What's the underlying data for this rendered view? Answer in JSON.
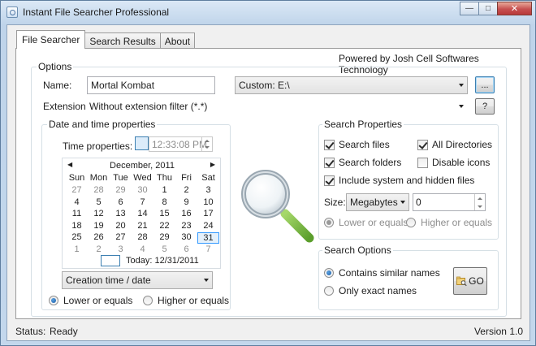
{
  "window": {
    "title": "Instant File Searcher Professional",
    "controls": [
      "minimize-icon",
      "maximize-icon",
      "close-icon"
    ]
  },
  "tabs": [
    {
      "label": "File Searcher",
      "active": true
    },
    {
      "label": "Search Results",
      "active": false
    },
    {
      "label": "About",
      "active": false
    }
  ],
  "header": {
    "powered_by": "Powered by Josh Cell Softwares Technology"
  },
  "options": {
    "legend": "Options",
    "name_label": "Name:",
    "name_value": "Mortal Kombat",
    "location_value": "Custom: E:\\",
    "browse_label": "...",
    "extension_label": "Extension:",
    "extension_value": "Without extension filter (*.*)",
    "help_label": "?"
  },
  "datetime": {
    "legend": "Date and time properties",
    "time_label": "Time properties:",
    "time_value": "12:33:08 PM",
    "calendar": {
      "month_label": "December, 2011",
      "weekdays": [
        "Sun",
        "Mon",
        "Tue",
        "Wed",
        "Thu",
        "Fri",
        "Sat"
      ],
      "weeks": [
        [
          "27",
          "28",
          "29",
          "30",
          "1",
          "2",
          "3"
        ],
        [
          "4",
          "5",
          "6",
          "7",
          "8",
          "9",
          "10"
        ],
        [
          "11",
          "12",
          "13",
          "14",
          "15",
          "16",
          "17"
        ],
        [
          "18",
          "19",
          "20",
          "21",
          "22",
          "23",
          "24"
        ],
        [
          "25",
          "26",
          "27",
          "28",
          "29",
          "30",
          "31"
        ],
        [
          "1",
          "2",
          "3",
          "4",
          "5",
          "6",
          "7"
        ]
      ],
      "selected_day": "31",
      "today_label": "Today: 12/31/2011"
    },
    "mode_value": "Creation time / date",
    "radio_lower": "Lower or equals",
    "radio_higher": "Higher or equals"
  },
  "search_properties": {
    "legend": "Search Properties",
    "search_files": "Search files",
    "all_directories": "All Directories",
    "search_folders": "Search folders",
    "disable_icons": "Disable icons",
    "include_system": "Include system and hidden files",
    "size_label": "Size:",
    "size_unit": "Megabytes",
    "size_value": "0",
    "radio_lower": "Lower or equals",
    "radio_higher": "Higher or equals"
  },
  "search_options": {
    "legend": "Search Options",
    "contains_similar": "Contains similar names",
    "only_exact": "Only exact names",
    "go_label": "GO"
  },
  "status": {
    "status_label": "Status:",
    "status_value": "Ready",
    "version": "Version 1.0"
  },
  "colors": {
    "accent": "#3c7fb1",
    "calendar_selected": "#3399ff",
    "magnifier_handle": "#7ac143"
  }
}
